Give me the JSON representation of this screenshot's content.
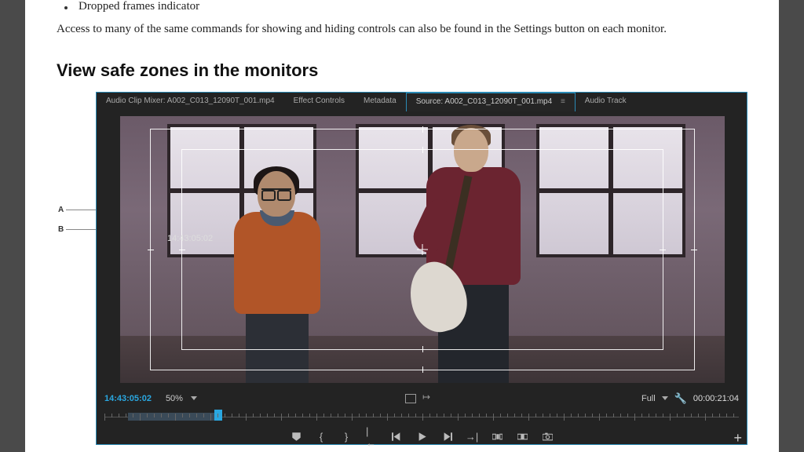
{
  "bullet": {
    "text": "Dropped frames indicator"
  },
  "paragraph": "Access to many of the same commands for showing and hiding controls can also be found in the Settings button on each monitor.",
  "heading": "View safe zones in the monitors",
  "callouts": {
    "a": "A",
    "b": "B"
  },
  "tabs": {
    "mixer": "Audio Clip Mixer: A002_C013_12090T_001.mp4",
    "effect": "Effect Controls",
    "metadata": "Metadata",
    "source": "Source: A002_C013_12090T_001.mp4",
    "source_x": "≡",
    "audiotrack": "Audio Track"
  },
  "overlay_tc": "14:43:05:02",
  "infobar": {
    "tc_left": "14:43:05:02",
    "zoom": "50%",
    "full": "Full",
    "tc_right": "00:00:21:04"
  },
  "transport": {
    "marker": "▼",
    "in": "{",
    "out": "}",
    "goto_in": "|←",
    "step_back": "◀|",
    "play": "▶",
    "step_fwd": "|▶",
    "goto_out": "→|",
    "insert": "⧉",
    "overwrite": "⧈",
    "export": "📷"
  },
  "plus": "+"
}
